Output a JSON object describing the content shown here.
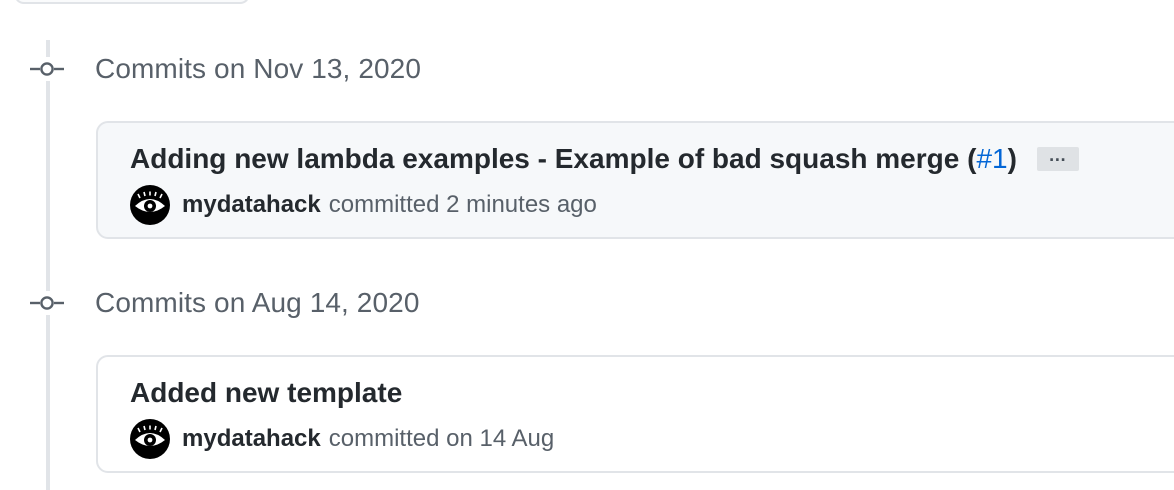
{
  "timeline": {
    "groups": [
      {
        "date_label": "Commits on Nov 13, 2020",
        "commit": {
          "message": "Adding new lambda examples - Example of bad squash merge (",
          "pr_link": "#1",
          "message_suffix": ")",
          "more_label": "…",
          "author": "mydatahack",
          "committed_text": "committed 2 minutes ago"
        }
      },
      {
        "date_label": "Commits on Aug 14, 2020",
        "commit": {
          "message": "Added new template",
          "author": "mydatahack",
          "committed_text": "committed on 14 Aug"
        }
      }
    ]
  },
  "icons": {
    "commit_node": "git-commit-icon",
    "avatar": "eye-avatar-icon",
    "more": "ellipsis-icon"
  },
  "colors": {
    "link": "#0366d6",
    "muted_text": "#586069",
    "primary_text": "#24292e",
    "border": "#e1e4e8",
    "highlight_bg": "#f6f8fa"
  }
}
